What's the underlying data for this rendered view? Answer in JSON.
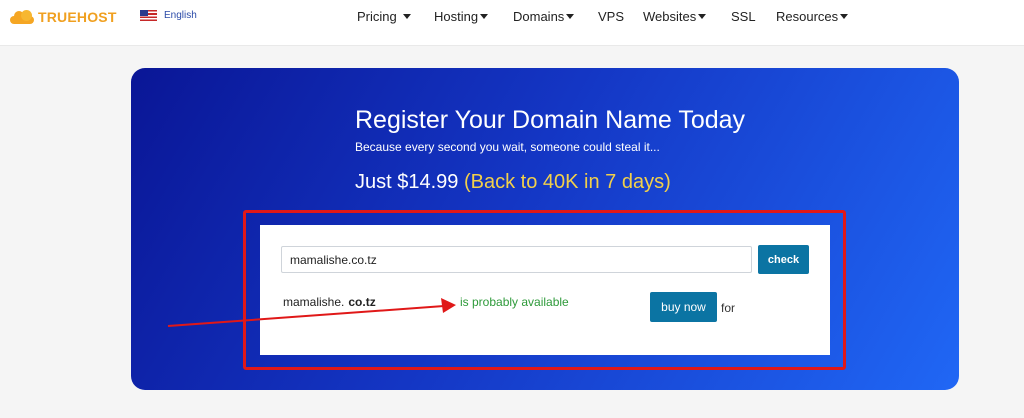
{
  "header": {
    "logo_text": "TRUEHOST",
    "language": "English",
    "nav": [
      {
        "label": "Pricing",
        "has_dropdown": true
      },
      {
        "label": "Hosting",
        "has_dropdown": true
      },
      {
        "label": "Domains",
        "has_dropdown": true
      },
      {
        "label": "VPS",
        "has_dropdown": false
      },
      {
        "label": "Websites",
        "has_dropdown": true
      },
      {
        "label": "SSL",
        "has_dropdown": false
      },
      {
        "label": "Resources",
        "has_dropdown": true
      }
    ]
  },
  "hero": {
    "title": "Register Your Domain Name Today",
    "subtitle": "Because every second you wait, someone could steal it...",
    "price_prefix": "Just $14.99",
    "price_promo": "(Back to 40K in 7 days)"
  },
  "search": {
    "input_value": "mamalishe.co.tz",
    "check_label": "check",
    "result_name": "mamalishe.",
    "result_tld": "co.tz",
    "availability": "is probably available",
    "buy_label": "buy now",
    "for_label": "for"
  },
  "colors": {
    "logo": "#f0a020",
    "hero_start": "#0a1696",
    "hero_end": "#2067f5",
    "button": "#0b74a3",
    "available": "#2e9a3a",
    "annotation": "#e01818",
    "promo": "#f2d04a"
  }
}
